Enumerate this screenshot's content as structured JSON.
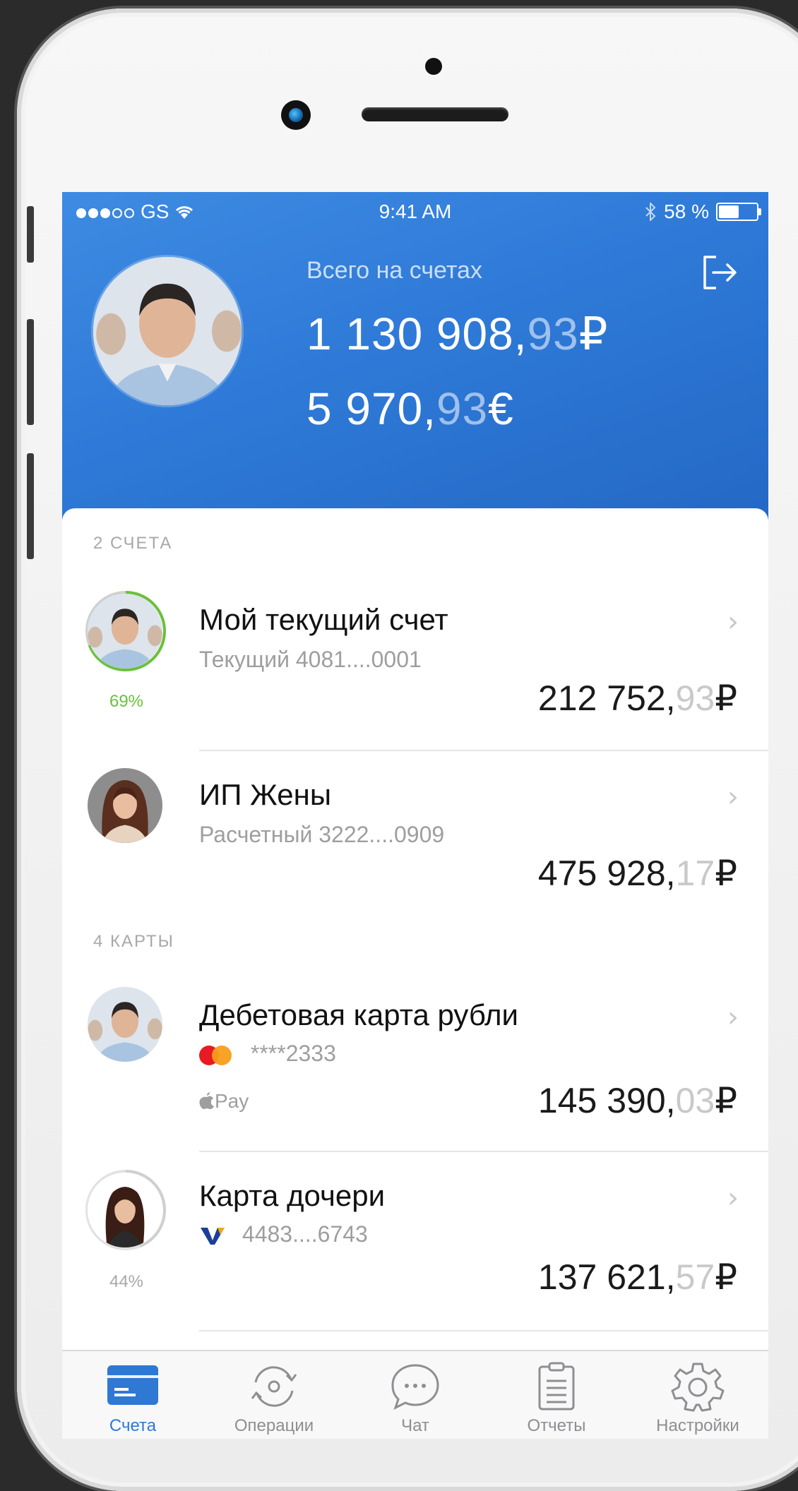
{
  "status_bar": {
    "carrier": "GS",
    "time": "9:41 AM",
    "battery": "58 %",
    "battery_level": 0.58
  },
  "header": {
    "caption": "Всего на счетах",
    "totals": [
      {
        "main": "1 130 908,",
        "cents": "93",
        "currency": "₽"
      },
      {
        "main": "5 970,",
        "cents": "93",
        "currency": "€"
      }
    ],
    "logout_icon": "logout-icon"
  },
  "accounts": {
    "section_title": "2 СЧЕТА",
    "items": [
      {
        "title": "Мой текущий счет",
        "subtitle": "Текущий 4081....0001",
        "main": "212 752,",
        "cents": "93",
        "currency": "₽",
        "percent": "69%",
        "progress": 0.69
      },
      {
        "title": "ИП Жены",
        "subtitle": "Расчетный 3222....0909",
        "main": "475 928,",
        "cents": "17",
        "currency": "₽"
      }
    ]
  },
  "cards": {
    "section_title": "4 КАРТЫ",
    "items": [
      {
        "title": "Дебетовая карта рубли",
        "number": "****2333",
        "pay": "Pay",
        "main": "145 390,",
        "cents": "03",
        "currency": "₽"
      },
      {
        "title": "Карта дочери",
        "number": "4483....6743",
        "main": "137 621,",
        "cents": "57",
        "currency": "₽",
        "percent": "44%",
        "progress": 0.44
      }
    ]
  },
  "tabbar": {
    "items": [
      {
        "label": "Счета",
        "icon": "card-icon",
        "active": true
      },
      {
        "label": "Операции",
        "icon": "exchange-icon"
      },
      {
        "label": "Чат",
        "icon": "chat-icon"
      },
      {
        "label": "Отчеты",
        "icon": "clipboard-icon"
      },
      {
        "label": "Настройки",
        "icon": "gear-icon"
      }
    ]
  },
  "colors": {
    "primary": "#2f78d4",
    "progress_green": "#6ac13a",
    "progress_gray": "#d0d0d0"
  }
}
